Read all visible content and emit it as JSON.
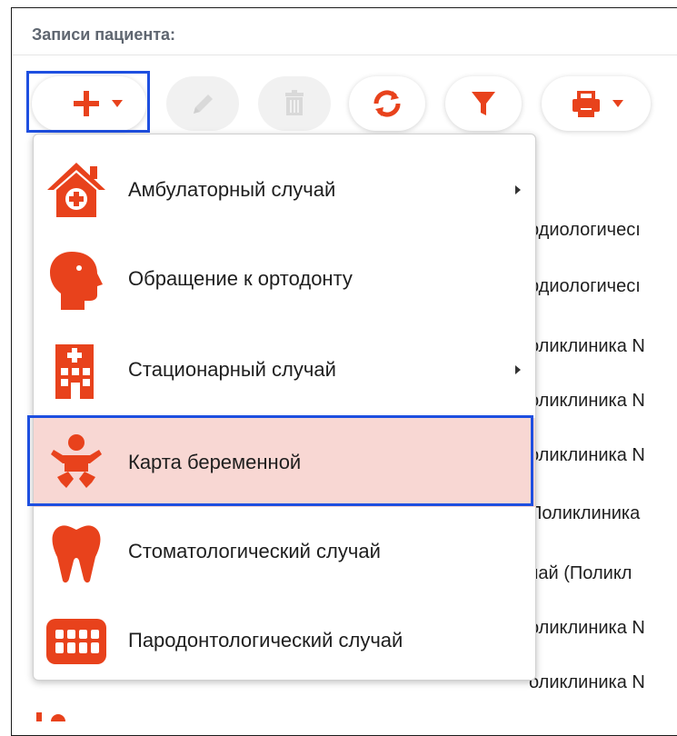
{
  "panel": {
    "title": "Записи пациента:"
  },
  "toolbar": {
    "add_icon": "plus-icon",
    "edit_icon": "pencil-icon",
    "delete_icon": "trash-icon",
    "refresh_icon": "refresh-icon",
    "filter_icon": "filter-icon",
    "print_icon": "print-icon",
    "accent": "#e8421c",
    "disabled": "#d9d9d9",
    "selection_outline": "#1e4fe0"
  },
  "menu": {
    "items": [
      {
        "label": "Амбулаторный случай",
        "icon": "clinic-house-icon",
        "submenu": true
      },
      {
        "label": "Обращение к ортодонту",
        "icon": "head-profile-icon",
        "submenu": false
      },
      {
        "label": "Стационарный случай",
        "icon": "hospital-building-icon",
        "submenu": true
      },
      {
        "label": "Карта беременной",
        "icon": "baby-icon",
        "submenu": false,
        "highlighted": true
      },
      {
        "label": "Стоматологический случай",
        "icon": "tooth-icon",
        "submenu": false
      },
      {
        "label": "Пародонтологический случай",
        "icon": "teeth-row-icon",
        "submenu": false
      }
    ],
    "highlight_color": "#f8d7d3"
  },
  "background_rows": [
    "рдиологичесı",
    "рдиологичесı",
    "оликлиника N",
    "оликлиника N",
    "оликлиника N",
    "Поликлиника",
    "чай (Поликл",
    "оликлиника N",
    "оликлиника N"
  ]
}
